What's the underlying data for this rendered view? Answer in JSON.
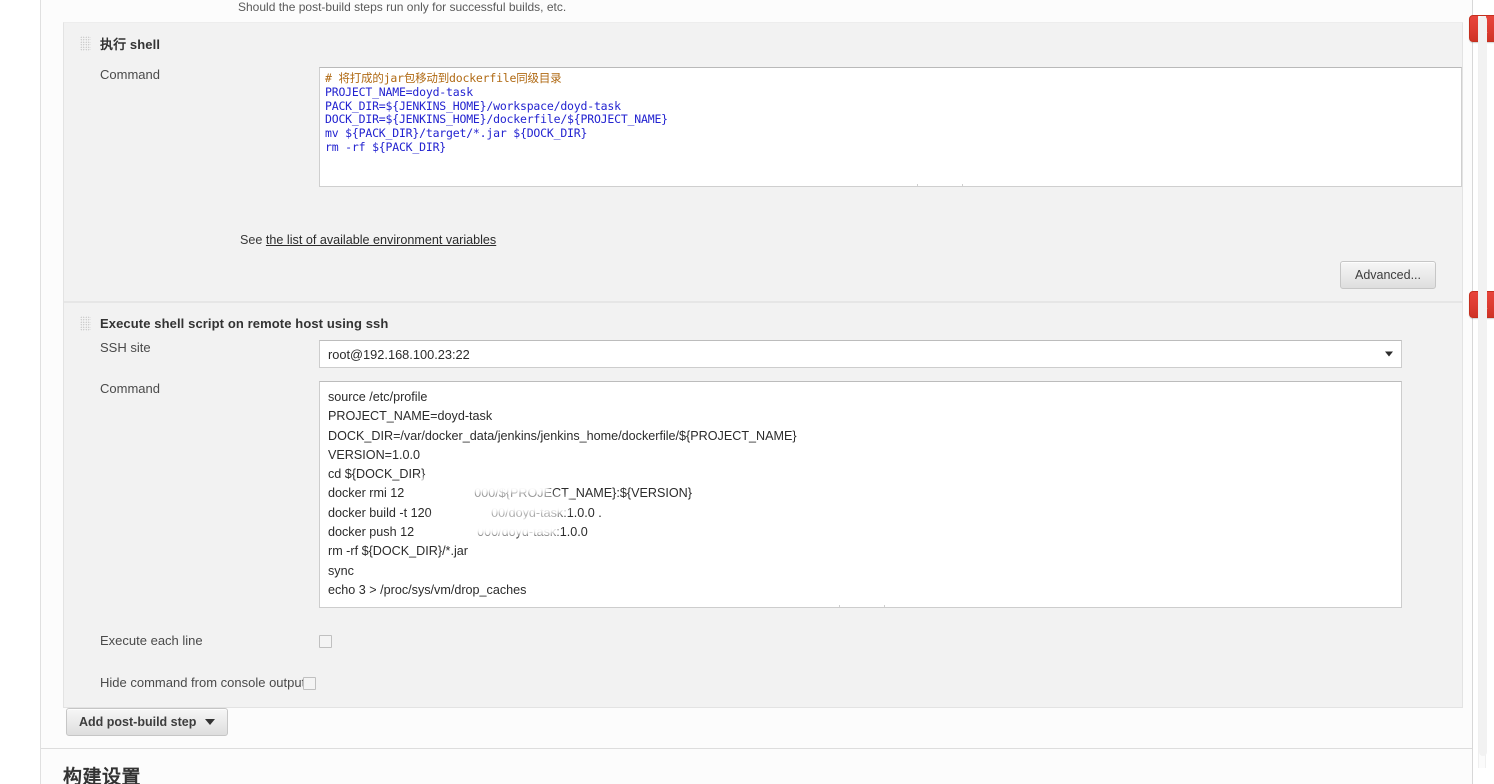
{
  "page": {
    "top_hint": "Should the post-build steps run only for successful builds, etc.",
    "bottom_heading": "构建设置"
  },
  "icons": {
    "delete": "X",
    "help": "?"
  },
  "blocks": [
    {
      "id": "execute-shell",
      "title": "执行 shell",
      "command_label": "Command",
      "code_lines": [
        {
          "text": "# 将打成的jar包移动到dockerfile同级目录",
          "style": "comment"
        },
        {
          "text": "PROJECT_NAME=doyd-task",
          "style": "plain"
        },
        {
          "text": "PACK_DIR=${JENKINS_HOME}/workspace/doyd-task",
          "style": "plain"
        },
        {
          "text": "DOCK_DIR=${JENKINS_HOME}/dockerfile/${PROJECT_NAME}",
          "style": "plain"
        },
        {
          "text": "mv ${PACK_DIR}/target/*.jar ${DOCK_DIR}",
          "style": "plain"
        },
        {
          "text": "rm -rf ${PACK_DIR}",
          "style": "plain"
        }
      ],
      "env_prefix": "See ",
      "env_link": "the list of available environment variables",
      "advanced_label": "Advanced..."
    },
    {
      "id": "execute-shell-ssh",
      "title": "Execute shell script on remote host using ssh",
      "ssh_site_label": "SSH site",
      "ssh_site_value": "root@192.168.100.23:22",
      "command_label": "Command",
      "command_lines": [
        "source /etc/profile",
        "PROJECT_NAME=doyd-task",
        "DOCK_DIR=/var/docker_data/jenkins/jenkins_home/dockerfile/${PROJECT_NAME}",
        "VERSION=1.0.0",
        "cd ${DOCK_DIR}",
        "docker rmi 12                    000/${PROJECT_NAME}:${VERSION}",
        "docker build -t 120                 00/doyd-task:1.0.0 .",
        "docker push 12                  000/doyd-task:1.0.0",
        "rm -rf ${DOCK_DIR}/*.jar",
        "sync",
        "echo 3 > /proc/sys/vm/drop_caches"
      ],
      "execute_each_line_label": "Execute each line",
      "hide_command_label": "Hide command from console output"
    }
  ],
  "footer": {
    "add_post_build_step": "Add post-build step"
  },
  "colors": {
    "delete_red": "#dd3c31",
    "code_comment": "#b06a14",
    "code_plain": "#2323d0",
    "panel_bg": "#f2f2f2"
  }
}
